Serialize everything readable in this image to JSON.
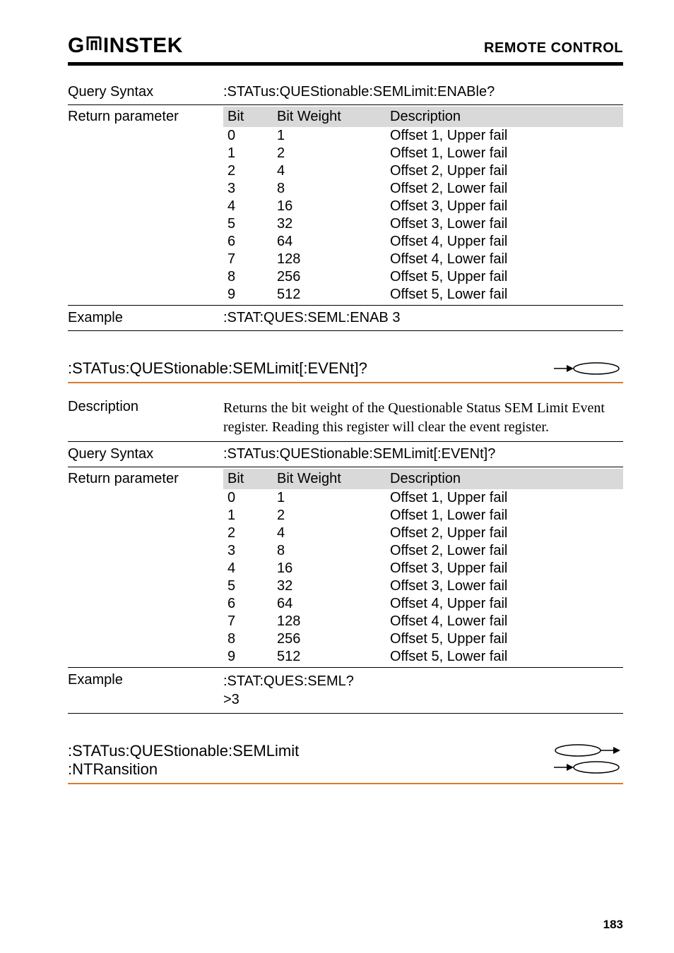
{
  "header": {
    "logo_left": "G",
    "logo_right": "INSTEK",
    "section": "REMOTE CONTROL"
  },
  "block1": {
    "query_label": "Query Syntax",
    "query_value": ":STATus:QUEStionable:SEMLimit:ENABle?",
    "return_label": "Return parameter",
    "col_bit": "Bit",
    "col_weight": "Bit Weight",
    "col_desc": "Description",
    "rows": [
      {
        "bit": "0",
        "weight": "1",
        "desc": "Offset 1, Upper fail"
      },
      {
        "bit": "1",
        "weight": "2",
        "desc": "Offset 1, Lower fail"
      },
      {
        "bit": "2",
        "weight": "4",
        "desc": "Offset 2, Upper fail"
      },
      {
        "bit": "3",
        "weight": "8",
        "desc": "Offset 2, Lower fail"
      },
      {
        "bit": "4",
        "weight": "16",
        "desc": "Offset 3, Upper fail"
      },
      {
        "bit": "5",
        "weight": "32",
        "desc": "Offset 3, Lower fail"
      },
      {
        "bit": "6",
        "weight": "64",
        "desc": "Offset 4, Upper fail"
      },
      {
        "bit": "7",
        "weight": "128",
        "desc": "Offset 4, Lower fail"
      },
      {
        "bit": "8",
        "weight": "256",
        "desc": "Offset 5, Upper fail"
      },
      {
        "bit": "9",
        "weight": "512",
        "desc": "Offset 5, Lower fail"
      }
    ],
    "example_label": "Example",
    "example_value": ":STAT:QUES:SEML:ENAB 3"
  },
  "block2": {
    "heading": ":STATus:QUEStionable:SEMLimit[:EVENt]?",
    "desc_label": "Description",
    "desc_text": "Returns the bit weight of the Questionable Status SEM Limit Event register. Reading this register will clear the event register.",
    "query_label": "Query Syntax",
    "query_value": ":STATus:QUEStionable:SEMLimit[:EVENt]?",
    "return_label": "Return parameter",
    "col_bit": "Bit",
    "col_weight": "Bit Weight",
    "col_desc": "Description",
    "rows": [
      {
        "bit": "0",
        "weight": "1",
        "desc": "Offset 1, Upper fail"
      },
      {
        "bit": "1",
        "weight": "2",
        "desc": "Offset 1, Lower fail"
      },
      {
        "bit": "2",
        "weight": "4",
        "desc": "Offset 2, Upper fail"
      },
      {
        "bit": "3",
        "weight": "8",
        "desc": "Offset 2, Lower fail"
      },
      {
        "bit": "4",
        "weight": "16",
        "desc": "Offset 3, Upper fail"
      },
      {
        "bit": "5",
        "weight": "32",
        "desc": "Offset 3, Lower fail"
      },
      {
        "bit": "6",
        "weight": "64",
        "desc": "Offset 4, Upper fail"
      },
      {
        "bit": "7",
        "weight": "128",
        "desc": "Offset 4, Lower fail"
      },
      {
        "bit": "8",
        "weight": "256",
        "desc": "Offset 5, Upper fail"
      },
      {
        "bit": "9",
        "weight": "512",
        "desc": "Offset 5, Lower fail"
      }
    ],
    "example_label": "Example",
    "example_line1": ":STAT:QUES:SEML?",
    "example_line2": ">3"
  },
  "block3": {
    "heading_line1": ":STATus:QUEStionable:SEMLimit",
    "heading_line2": ":NTRansition"
  },
  "page_number": "183"
}
